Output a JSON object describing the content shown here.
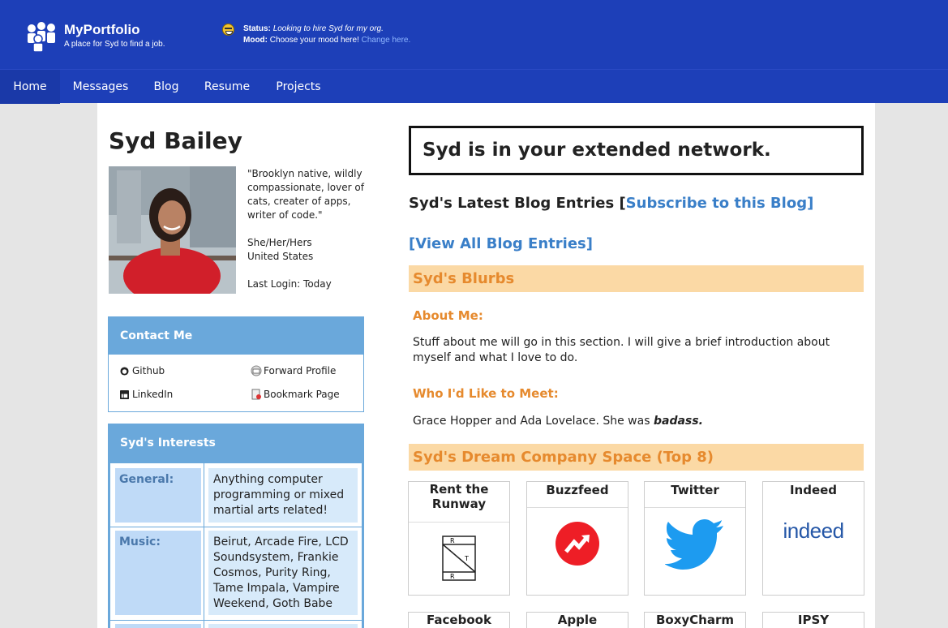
{
  "header": {
    "brand": "MyPortfolio",
    "tagline": "A place for Syd to find a job.",
    "status_label": "Status:",
    "status_text": "Looking to hire Syd for my org.",
    "mood_label": "Mood:",
    "mood_text": "Choose your mood here!",
    "mood_link": "Change here."
  },
  "nav": [
    "Home",
    "Messages",
    "Blog",
    "Resume",
    "Projects"
  ],
  "profile": {
    "name": "Syd Bailey",
    "quote": "\"Brooklyn native, wildly compassionate, lover of cats, creater of apps, writer of code.\"",
    "pronouns": "She/Her/Hers",
    "country": "United States",
    "last_login": "Last Login: Today"
  },
  "contact": {
    "title": "Contact Me",
    "github": "Github",
    "linkedin": "LinkedIn",
    "forward": "Forward Profile",
    "bookmark": "Bookmark Page"
  },
  "interests": {
    "title": "Syd's Interests",
    "general_label": "General:",
    "general_value": "Anything computer programming or mixed martial arts related!",
    "music_label": "Music:",
    "music_value": "Beirut, Arcade Fire, LCD Soundsystem, Frankie Cosmos, Purity Ring, Tame Impala, Vampire Weekend, Goth Babe"
  },
  "network": "Syd is in your extended network.",
  "blog": {
    "heading": "Syd's Latest Blog Entries [",
    "subscribe": "Subscribe to this Blog]",
    "view_all": "[View All Blog Entries]"
  },
  "blurbs": {
    "title": "Syd's Blurbs",
    "about_head": "About Me:",
    "about_text": "Stuff about me will go in this section. I will give a brief introduction about myself and what I love to do.",
    "meet_head": "Who I'd Like to Meet:",
    "meet_text": "Grace Hopper and Ada Lovelace. She was",
    "meet_emph": "badass."
  },
  "dream": {
    "title": "Syd's Dream Company Space (Top 8)",
    "companies": [
      "Rent the Runway",
      "Buzzfeed",
      "Twitter",
      "Indeed",
      "Facebook",
      "Apple",
      "BoxyCharm",
      "IPSY"
    ],
    "indeed_logo_text": "indeed"
  },
  "colors": {
    "header_blue": "#1d3fb8",
    "panel_blue": "#6aa8db",
    "blurb_orange": "#e68a2e",
    "blurb_bg": "#fbd9a5",
    "link_blue": "#3a7fc8"
  }
}
